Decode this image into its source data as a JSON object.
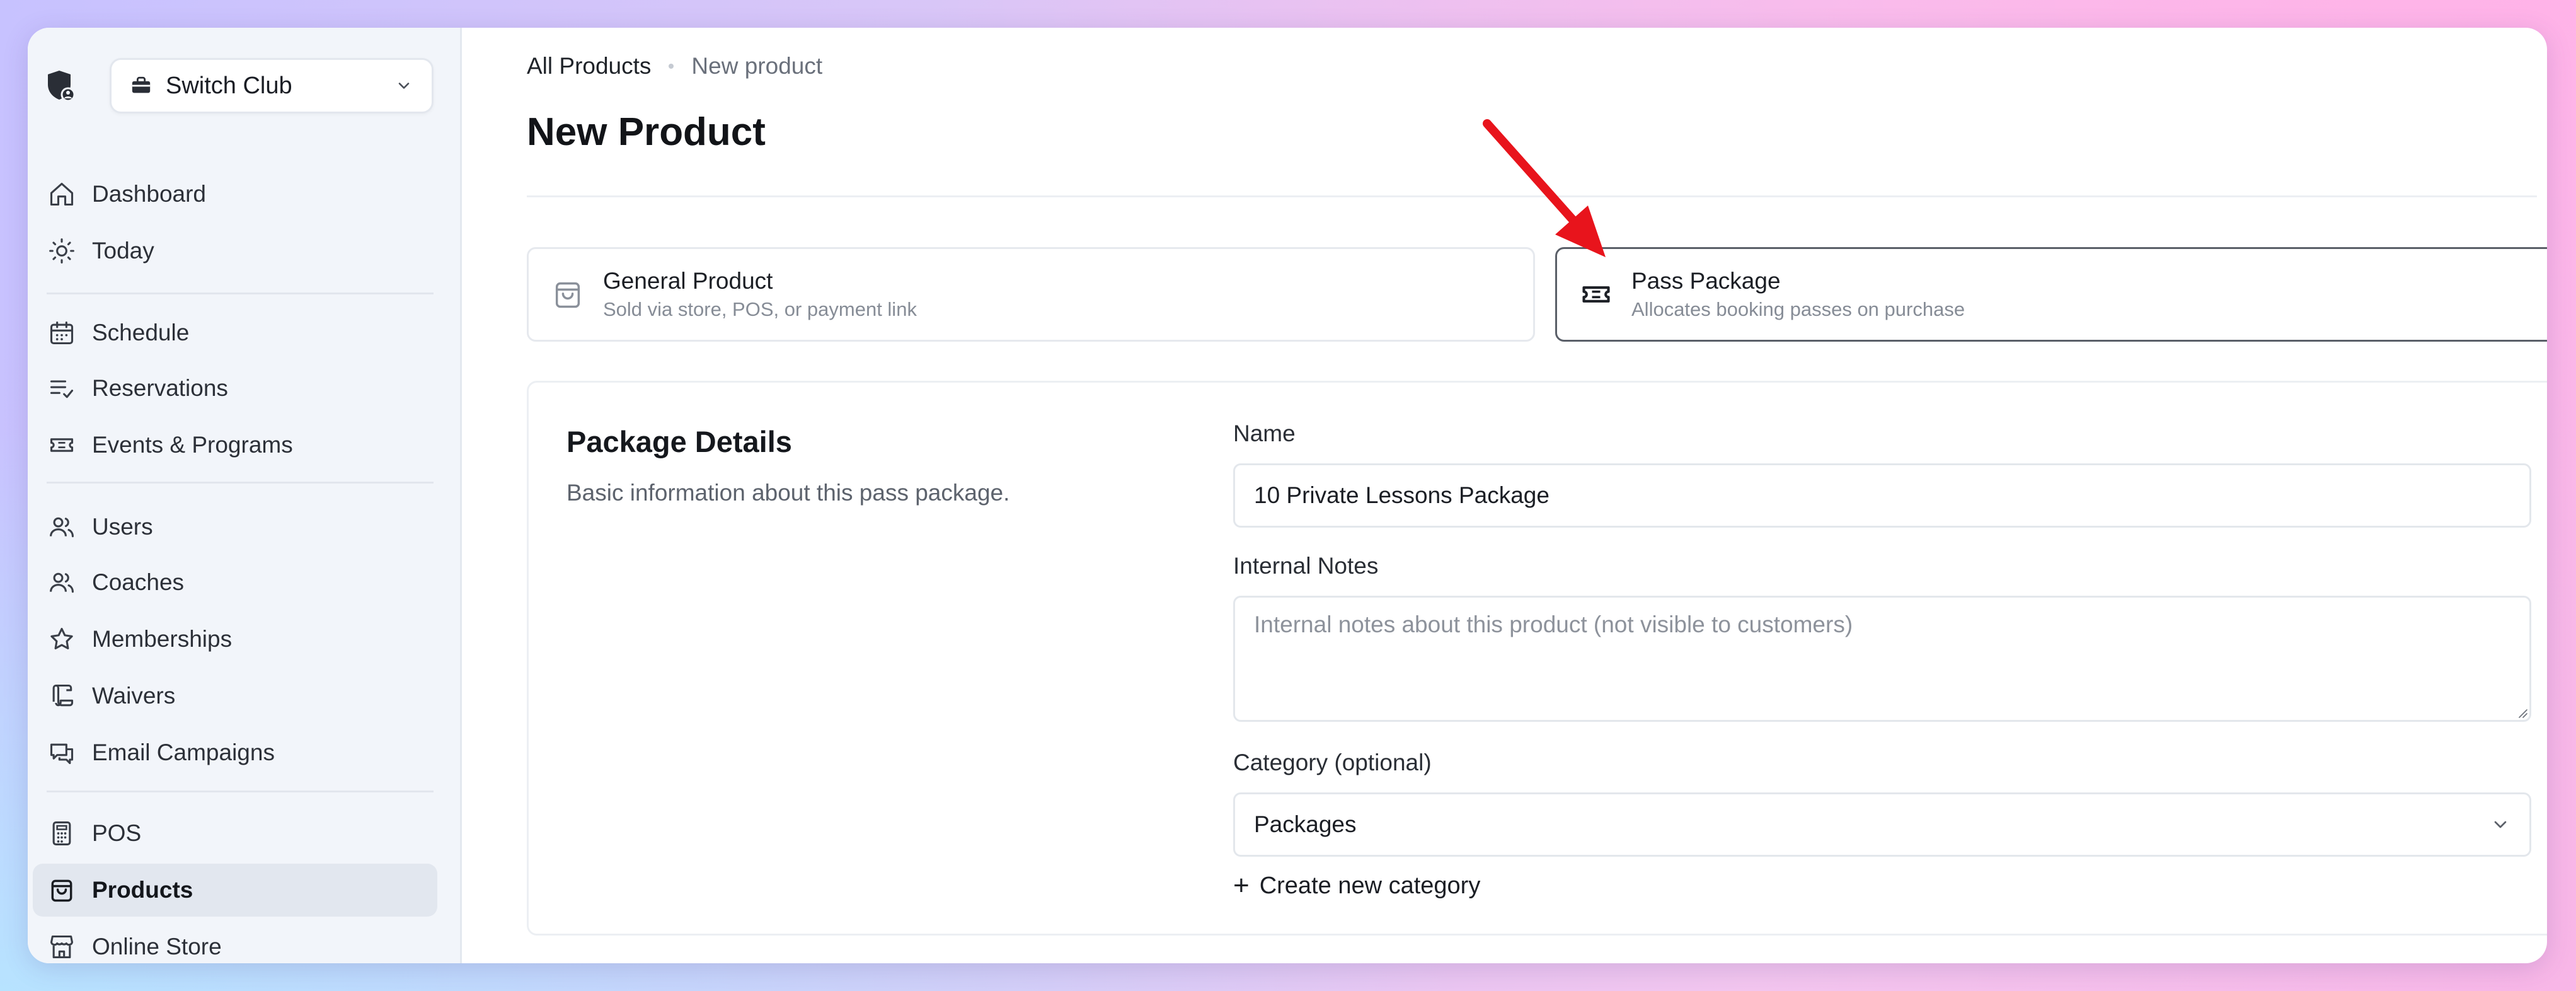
{
  "sidebar": {
    "club_name": "Switch Club",
    "items": [
      {
        "label": "Dashboard",
        "icon": "home-icon"
      },
      {
        "label": "Today",
        "icon": "sun-icon"
      },
      {
        "label": "Schedule",
        "icon": "calendar-icon"
      },
      {
        "label": "Reservations",
        "icon": "list-check-icon"
      },
      {
        "label": "Events & Programs",
        "icon": "ticket-icon"
      },
      {
        "label": "Users",
        "icon": "users-icon"
      },
      {
        "label": "Coaches",
        "icon": "users-icon"
      },
      {
        "label": "Memberships",
        "icon": "star-icon"
      },
      {
        "label": "Waivers",
        "icon": "scroll-icon"
      },
      {
        "label": "Email Campaigns",
        "icon": "chat-icon"
      },
      {
        "label": "POS",
        "icon": "calculator-icon"
      },
      {
        "label": "Products",
        "icon": "shopping-bag-icon",
        "active": true
      },
      {
        "label": "Online Store",
        "icon": "store-icon"
      }
    ]
  },
  "breadcrumb": {
    "parent": "All Products",
    "current": "New product"
  },
  "page": {
    "title": "New Product"
  },
  "product_types": {
    "general": {
      "title": "General Product",
      "description": "Sold via store, POS, or payment link"
    },
    "pass": {
      "title": "Pass Package",
      "description": "Allocates booking passes on purchase",
      "selected": true
    }
  },
  "details": {
    "title": "Package Details",
    "description": "Basic information about this pass package.",
    "name_label": "Name",
    "name_value": "10 Private Lessons Package",
    "notes_label": "Internal Notes",
    "notes_placeholder": "Internal notes about this product (not visible to customers)",
    "category_label": "Category (optional)",
    "category_value": "Packages",
    "create_category_label": "Create new category"
  },
  "colors": {
    "accent_arrow": "#e8141c",
    "sidebar_bg": "#f2f5fa",
    "active_item_bg": "#e2e7ef",
    "selected_card_border": "#5a5f68"
  }
}
